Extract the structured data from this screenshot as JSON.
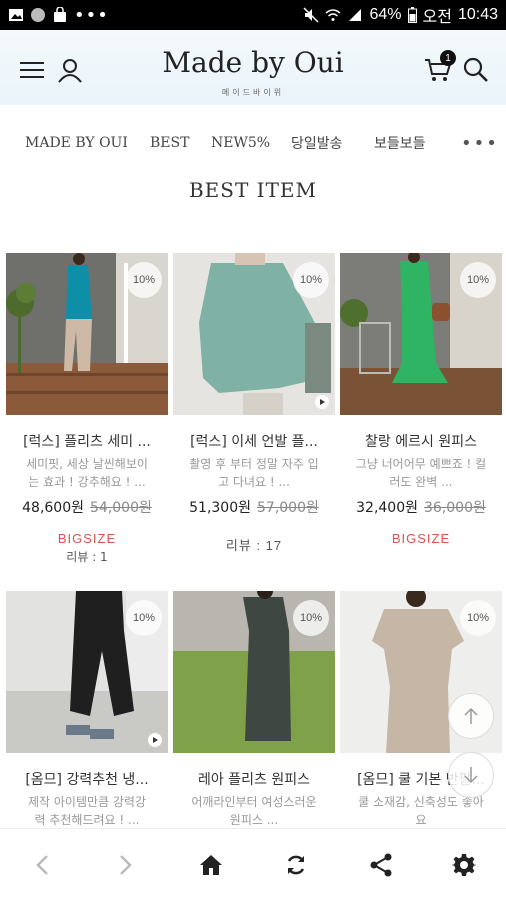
{
  "status_bar": {
    "battery": "64%",
    "ampm": "오전",
    "time": "10:43"
  },
  "header": {
    "logo": "Made by Oui",
    "logo_sub": "메이드바이위",
    "cart_count": "1"
  },
  "nav": {
    "items": [
      "MADE BY OUI",
      "BEST",
      "NEW5%",
      "당일발송",
      "보들보들"
    ]
  },
  "section": {
    "title": "BEST ITEM"
  },
  "products": [
    {
      "discount": "10%",
      "name": "[럭스] 플리츠 세미 ...",
      "desc1": "세미핏, 세상 날씬해보이",
      "desc2": "는 효과 ! 강추해요 ! ...",
      "price": "48,600원",
      "orig_price": "54,000원",
      "tag": "BIGSIZE",
      "review": "리뷰 : 1"
    },
    {
      "discount": "10%",
      "name": "[럭스] 이세 언발 플...",
      "desc1": "촬영 후 부터 정말 자주 입",
      "desc2": "고 다녀요 ! ...",
      "price": "51,300원",
      "orig_price": "57,000원",
      "tag": "",
      "review": "리뷰 : 17"
    },
    {
      "discount": "10%",
      "name": "찰랑 에르시 원피스",
      "desc1": "그냥 너어어무 예쁘죠 ! 컬",
      "desc2": "러도 완벽 ...",
      "price": "32,400원",
      "orig_price": "36,000원",
      "tag": "BIGSIZE",
      "review": ""
    },
    {
      "discount": "10%",
      "name": "[옴므] 강력추천 냉...",
      "desc1": "제작 아이템만큼 강력강",
      "desc2": "력 추천해드려요 ! ...",
      "price": "",
      "orig_price": "",
      "tag": "",
      "review": ""
    },
    {
      "discount": "10%",
      "name": "레아 플리츠 원피스",
      "desc1": "어깨라인부터 여성스러운",
      "desc2": "원피스 ...",
      "price": "",
      "orig_price": "",
      "tag": "",
      "review": ""
    },
    {
      "discount": "10%",
      "name": "[옴므] 쿨 기본 반팔...",
      "desc1": "쿨 소재감, 신축성도 좋아",
      "desc2": "요",
      "price": "",
      "orig_price": "",
      "tag": "",
      "review": ""
    }
  ]
}
